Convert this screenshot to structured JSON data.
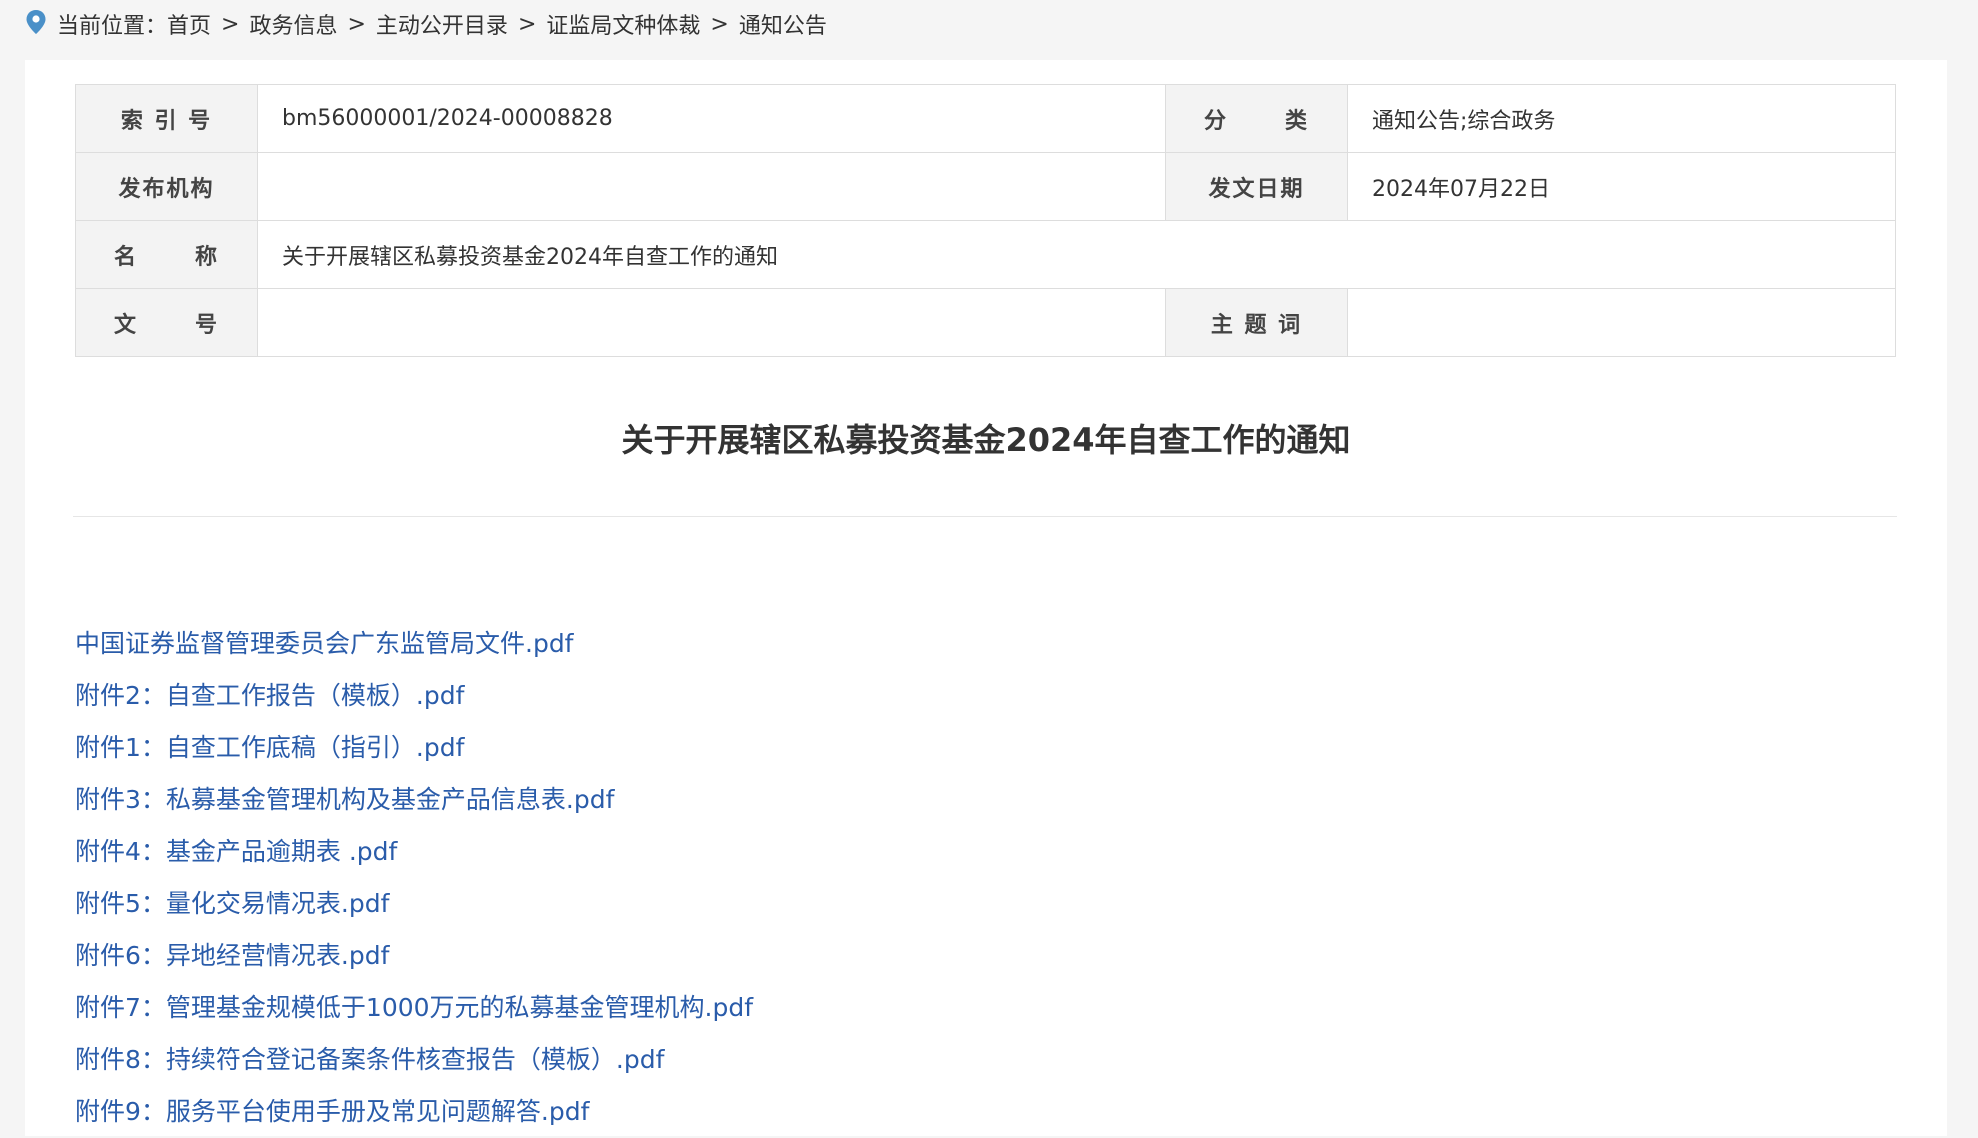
{
  "breadcrumb": {
    "prefix": "当前位置：",
    "items": [
      "首页",
      "政务信息",
      "主动公开目录",
      "证监局文种体裁",
      "通知公告"
    ],
    "separator": ">"
  },
  "meta": {
    "index_label": "索 引 号",
    "index_value": "bm56000001/2024-00008828",
    "category_label_a": "分",
    "category_label_b": "类",
    "category_value": "通知公告;综合政务",
    "publisher_label": "发布机构",
    "publisher_value": "",
    "date_label": "发文日期",
    "date_value": "2024年07月22日",
    "name_label_a": "名",
    "name_label_b": "称",
    "name_value": "关于开展辖区私募投资基金2024年自查工作的通知",
    "docno_label_a": "文",
    "docno_label_b": "号",
    "docno_value": "",
    "keywords_label": "主 题 词",
    "keywords_value": ""
  },
  "document": {
    "title": "关于开展辖区私募投资基金2024年自查工作的通知"
  },
  "attachments": [
    "中国证券监督管理委员会广东监管局文件.pdf",
    "附件2：自查工作报告（模板）.pdf",
    "附件1：自查工作底稿（指引）.pdf",
    "附件3：私募基金管理机构及基金产品信息表.pdf",
    "附件4：基金产品逾期表 .pdf",
    "附件5：量化交易情况表.pdf",
    "附件6：异地经营情况表.pdf",
    "附件7：管理基金规模低于1000万元的私募基金管理机构.pdf",
    "附件8：持续符合登记备案条件核查报告（模板）.pdf",
    "附件9：服务平台使用手册及常见问题解答.pdf"
  ],
  "colors": {
    "link": "#2a5caa",
    "pin": "#4a90c8",
    "label_bg": "#f3f3f3",
    "border": "#dddddd"
  }
}
